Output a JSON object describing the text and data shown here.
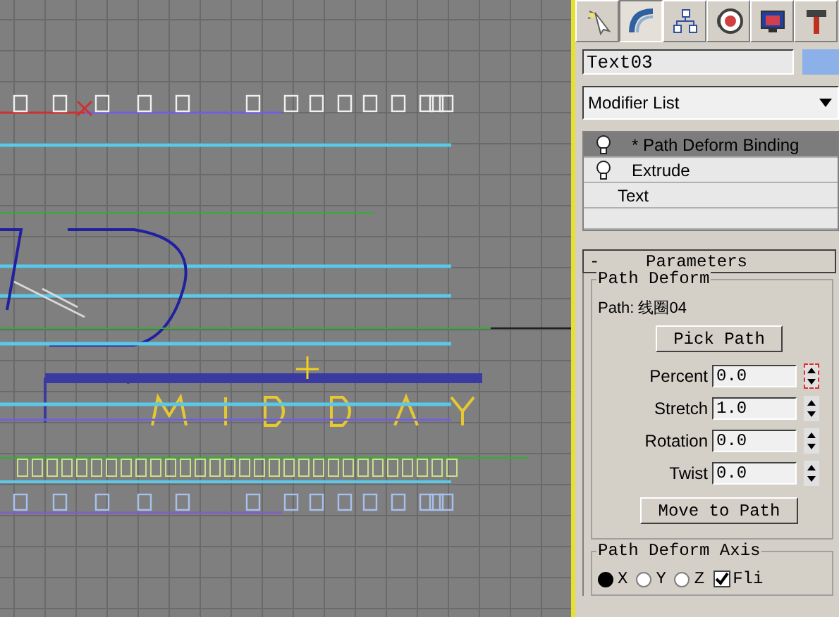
{
  "command_tabs": [
    {
      "kind": "create",
      "selected": false
    },
    {
      "kind": "modify",
      "selected": true
    },
    {
      "kind": "hierarchy",
      "selected": false
    },
    {
      "kind": "motion",
      "selected": false
    },
    {
      "kind": "display",
      "selected": false
    },
    {
      "kind": "utilities",
      "selected": false
    }
  ],
  "object_name": "Text03",
  "modifier_list": "Modifier List",
  "stack": [
    {
      "label": "* Path Deform Binding",
      "bulb": true,
      "selected": true
    },
    {
      "label": "Extrude",
      "bulb": true,
      "selected": false
    },
    {
      "label": "Text",
      "bulb": false,
      "selected": false
    }
  ],
  "rollout": {
    "sign": "-",
    "title": "Parameters"
  },
  "path_deform": {
    "title": "Path Deform",
    "path_label": "Path: 线圈04",
    "pick_button": "Pick Path",
    "spinners": [
      {
        "label": "Percent",
        "value": "0.0",
        "active": true
      },
      {
        "label": "Stretch",
        "value": "1.0",
        "active": false
      },
      {
        "label": "Rotation",
        "value": "0.0",
        "active": false
      },
      {
        "label": "Twist",
        "value": "0.0",
        "active": false
      }
    ],
    "move_button": "Move to Path"
  },
  "axis_group": {
    "title": "Path Deform Axis",
    "axes": [
      {
        "label": "X",
        "selected": true
      },
      {
        "label": "Y",
        "selected": false
      },
      {
        "label": "Z",
        "selected": false
      }
    ],
    "flip": {
      "label": "Fli",
      "checked": true
    }
  }
}
